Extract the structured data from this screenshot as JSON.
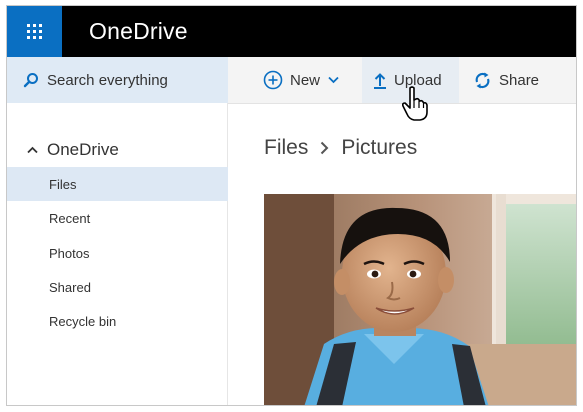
{
  "app": {
    "title": "OneDrive"
  },
  "search": {
    "label": "Search everything"
  },
  "commands": {
    "new": "New",
    "upload": "Upload",
    "share": "Share"
  },
  "nav": {
    "header": "OneDrive",
    "items": [
      {
        "label": "Files",
        "active": true
      },
      {
        "label": "Recent"
      },
      {
        "label": "Photos"
      },
      {
        "label": "Shared"
      },
      {
        "label": "Recycle bin"
      }
    ]
  },
  "breadcrumb": [
    "Files",
    "Pictures"
  ],
  "colors": {
    "brand_blue": "#0a6fc2",
    "suitebar": "#000000",
    "nav_active": "#dde8f4",
    "search_bg": "#dfeaf5"
  },
  "icons": [
    "waffle-icon",
    "search-icon",
    "plus-circle-icon",
    "chevron-down-icon",
    "upload-arrow-icon",
    "share-icon",
    "chevron-up-icon",
    "chevron-right-icon",
    "hand-cursor-icon"
  ]
}
